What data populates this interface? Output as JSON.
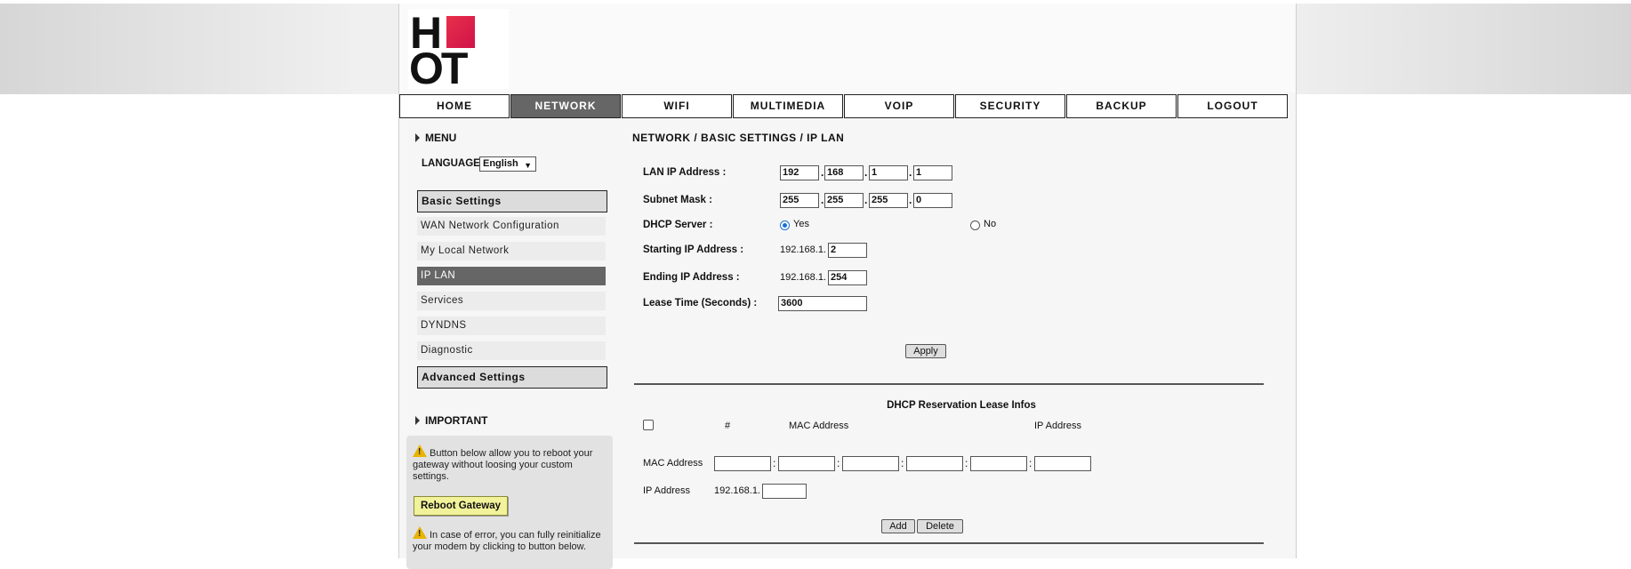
{
  "logo": {
    "letters_top": "H",
    "letters_bottom": "OT"
  },
  "nav": [
    "HOME",
    "NETWORK",
    "WIFI",
    "MULTIMEDIA",
    "VOIP",
    "SECURITY",
    "BACKUP",
    "LOGOUT"
  ],
  "nav_active": "NETWORK",
  "sidebar": {
    "menu_label": "MENU",
    "language_label": "LANGUAGE",
    "language_value": "English",
    "basic_settings": "Basic Settings",
    "items": [
      "WAN Network Configuration",
      "My Local Network",
      "IP LAN",
      "Services",
      "DYNDNS",
      "Diagnostic"
    ],
    "active_item": "IP LAN",
    "advanced_settings": "Advanced Settings",
    "important_label": "IMPORTANT",
    "important_text_1": "Button below allow you to reboot your gateway without loosing your custom settings.",
    "reboot_button": "Reboot Gateway",
    "important_text_2": "In case of error, you can fully reinitialize your modem by clicking to button below."
  },
  "breadcrumb": "NETWORK / BASIC SETTINGS / IP LAN",
  "form": {
    "lan_ip_label": "LAN IP Address :",
    "lan_ip": [
      "192",
      "168",
      "1",
      "1"
    ],
    "subnet_label": "Subnet Mask :",
    "subnet": [
      "255",
      "255",
      "255",
      "0"
    ],
    "dhcp_label": "DHCP Server :",
    "dhcp_yes": "Yes",
    "dhcp_no": "No",
    "dhcp_selected": "Yes",
    "start_label": "Starting IP Address :",
    "start_prefix": "192.168.1.",
    "start_value": "2",
    "end_label": "Ending IP Address :",
    "end_prefix": "192.168.1.",
    "end_value": "254",
    "lease_label": "Lease Time (Seconds) :",
    "lease_value": "3600",
    "apply_button": "Apply"
  },
  "reservation": {
    "title": "DHCP Reservation Lease Infos",
    "col_hash": "#",
    "col_mac": "MAC Address",
    "col_ip": "IP Address",
    "mac_label": "MAC Address",
    "ip_label": "IP Address",
    "ip_prefix": "192.168.1.",
    "add_button": "Add",
    "delete_button": "Delete"
  }
}
